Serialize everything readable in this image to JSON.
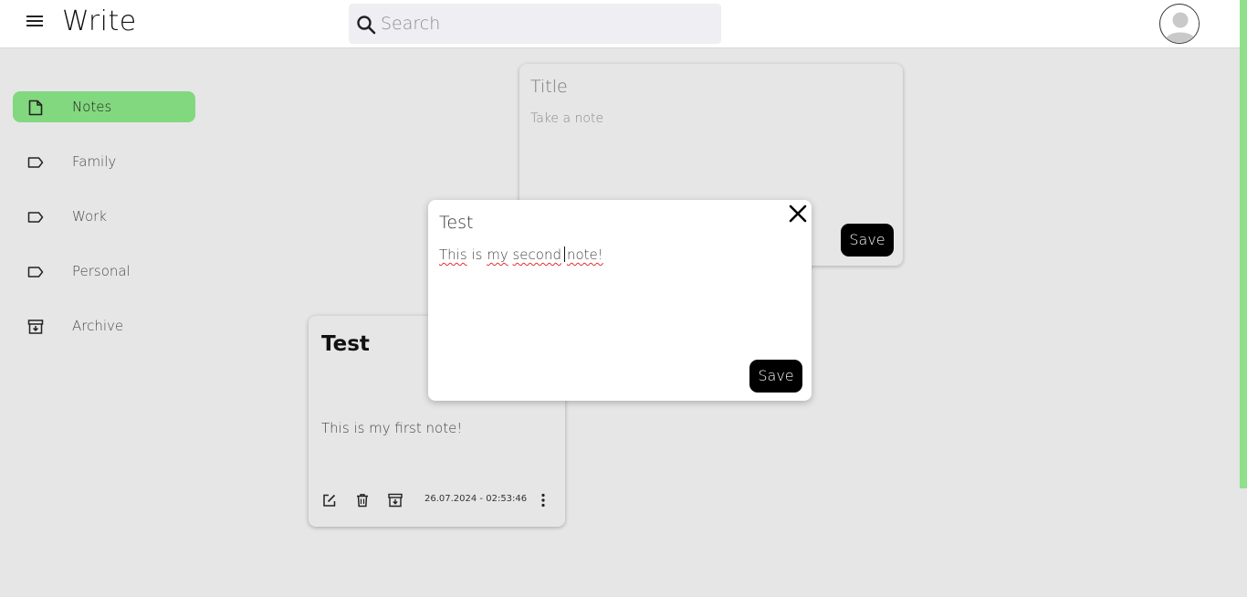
{
  "app": {
    "title": "Write"
  },
  "search": {
    "placeholder": "Search"
  },
  "sidebar": {
    "items": [
      {
        "label": "Notes",
        "icon": "note-icon",
        "active": true
      },
      {
        "label": "Family",
        "icon": "label-icon",
        "active": false
      },
      {
        "label": "Work",
        "icon": "label-icon",
        "active": false
      },
      {
        "label": "Personal",
        "icon": "label-icon",
        "active": false
      },
      {
        "label": "Archive",
        "icon": "archive-icon",
        "active": false
      }
    ]
  },
  "composer": {
    "title_placeholder": "Title",
    "body_placeholder": "Take a note",
    "save_label": "Save"
  },
  "note_card": {
    "title": "Test",
    "body": "This is my first note!",
    "date": "26.07.2024 - 02:53:46",
    "actions": [
      "edit-icon",
      "trash-icon",
      "archive-icon",
      "more-vertical-icon"
    ]
  },
  "edit_modal": {
    "title": "Test",
    "body_words": [
      "This",
      "is",
      "my",
      "second",
      "note!"
    ],
    "save_label": "Save"
  },
  "colors": {
    "accent": "#82d87f",
    "background": "#e6e6e6",
    "button": "#000000",
    "spellcheck": "#e03030"
  }
}
